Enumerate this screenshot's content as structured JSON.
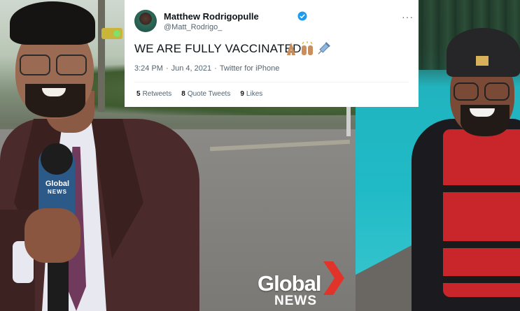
{
  "tweet": {
    "display_name": "Matthew Rodrigopulle",
    "handle": "@Matt_Rodrigo_",
    "text": "WE ARE FULLY VACCINATED",
    "emojis": [
      "folded-hands-icon",
      "raised-hands-icon",
      "syringe-icon"
    ],
    "time": "3:24 PM",
    "dot": "·",
    "date": "Jun 4, 2021",
    "source": "Twitter for iPhone",
    "more": "···",
    "stats": [
      {
        "count": "5",
        "label": "Retweets"
      },
      {
        "count": "8",
        "label": "Quote Tweets"
      },
      {
        "count": "9",
        "label": "Likes"
      }
    ]
  },
  "microphone": {
    "brand": "Global",
    "sub": "NEWS"
  },
  "logo": {
    "word": "Global",
    "sub": "NEWS",
    "chevron_color": "#e2332a"
  },
  "colors": {
    "verified": "#1d9bf0",
    "mic_flag": "#2c5a88",
    "vest": "#c9262c",
    "water": "#1fbac6"
  }
}
